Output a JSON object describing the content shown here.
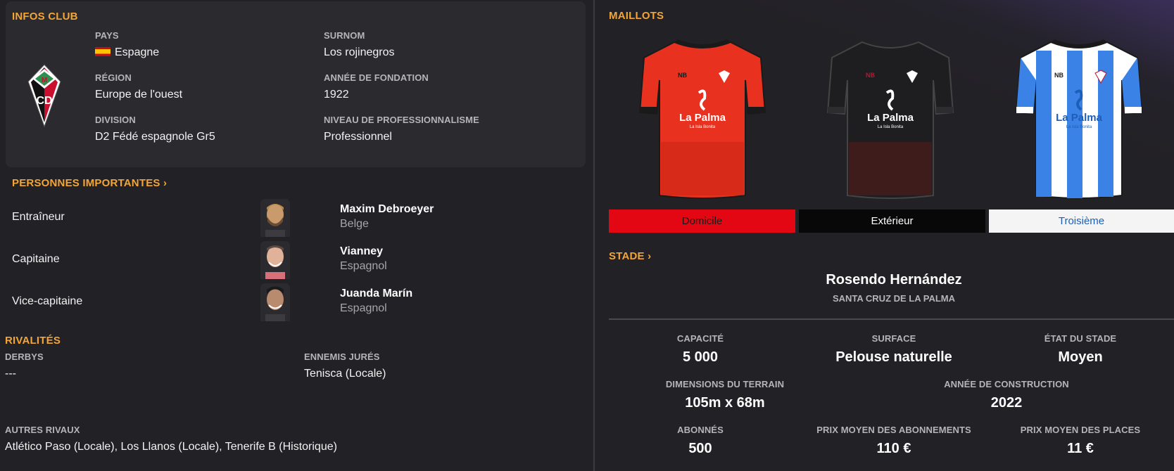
{
  "club_info": {
    "title": "INFOS CLUB",
    "pays_label": "PAYS",
    "pays_value": "Espagne",
    "surnom_label": "SURNOM",
    "surnom_value": "Los rojinegros",
    "region_label": "RÉGION",
    "region_value": "Europe de l'ouest",
    "fondation_label": "ANNÉE DE FONDATION",
    "fondation_value": "1922",
    "division_label": "DIVISION",
    "division_value": "D2 Fédé espagnole Gr5",
    "niveau_label": "NIVEAU DE PROFESSIONNALISME",
    "niveau_value": "Professionnel"
  },
  "persons": {
    "title": "PERSONNES IMPORTANTES",
    "items": [
      {
        "role": "Entraîneur",
        "name": "Maxim Debroeyer",
        "nationality": "Belge"
      },
      {
        "role": "Capitaine",
        "name": "Vianney",
        "nationality": "Espagnol"
      },
      {
        "role": "Vice-capitaine",
        "name": "Juanda Marín",
        "nationality": "Espagnol"
      }
    ]
  },
  "rivalries": {
    "title": "RIVALITÉS",
    "derbys_label": "DERBYS",
    "derbys_value": "---",
    "ennemis_label": "ENNEMIS JURÉS",
    "ennemis_value": "Tenisca (Locale)",
    "autres_label": "AUTRES RIVAUX",
    "autres_value": "Atlético Paso (Locale), Los Llanos (Locale), Tenerife B (Historique)"
  },
  "kits": {
    "title": "MAILLOTS",
    "sponsor": "La Palma",
    "sponsor_sub": "La Isla Bonita",
    "buttons": [
      {
        "label": "Domicile",
        "bg": "#e30613",
        "fg": "#1a1a1a"
      },
      {
        "label": "Extérieur",
        "bg": "#080808",
        "fg": "#ffffff"
      },
      {
        "label": "Troisième",
        "bg": "#f4f4f4",
        "fg": "#1d5fb8"
      }
    ]
  },
  "stadium": {
    "title": "STADE",
    "name": "Rosendo Hernández",
    "city": "SANTA CRUZ DE LA PALMA",
    "capacite_label": "CAPACITÉ",
    "capacite_value": "5 000",
    "surface_label": "SURFACE",
    "surface_value": "Pelouse naturelle",
    "etat_label": "ÉTAT DU STADE",
    "etat_value": "Moyen",
    "dimensions_label": "DIMENSIONS DU TERRAIN",
    "dimensions_value": "105m x 68m",
    "construction_label": "ANNÉE DE CONSTRUCTION",
    "construction_value": "2022",
    "abonnes_label": "ABONNÉS",
    "abonnes_value": "500",
    "prix_abo_label": "PRIX MOYEN DES ABONNEMENTS",
    "prix_abo_value": "110 €",
    "prix_places_label": "PRIX MOYEN DES PLACES",
    "prix_places_value": "11 €"
  },
  "colors": {
    "accent": "#f3a537",
    "background": "#222125",
    "card": "#2b2a2f"
  }
}
